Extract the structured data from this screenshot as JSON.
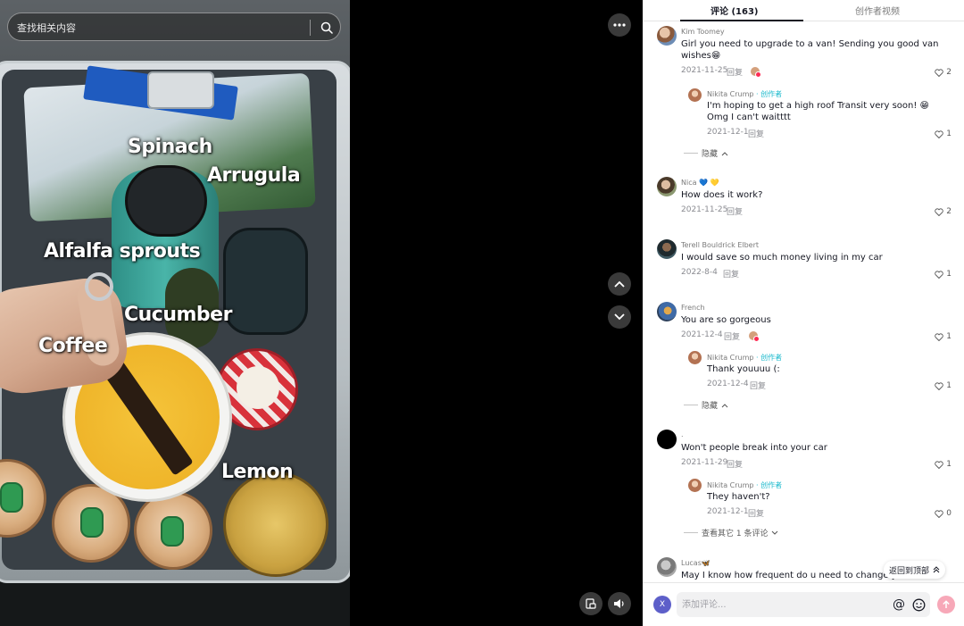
{
  "video": {
    "search_placeholder": "查找相关内容",
    "food_labels": {
      "spinach": "Spinach",
      "arrugula": "Arrugula",
      "alfalfa": "Alfalfa sprouts",
      "cucumber": "Cucumber",
      "coffee": "Coffee",
      "lemon": "Lemon"
    },
    "icons": {
      "search": "search-icon",
      "more": "more-horizontal-icon",
      "up": "chevron-up-icon",
      "down": "chevron-down-icon",
      "miniplayer": "miniplayer-icon",
      "volume": "volume-icon"
    }
  },
  "tabs": {
    "comments": "评论 (163)",
    "creator_videos": "创作者视频"
  },
  "comments": [
    {
      "user": "Kim Toomey",
      "text_line1": "Girl you need to upgrade to a van! Sending you good van",
      "text_line2": "wishes😁",
      "date": "2021-11-25",
      "reply": "回复",
      "likes": "2",
      "replies": [
        {
          "user": "Nikita Crump",
          "author_tag": "· 创作者",
          "text_line1": "I'm hoping to get a high roof Transit very soon! 😁",
          "text_line2": "Omg I can't waitttt",
          "date": "2021-12-1",
          "reply": "回复",
          "likes": "1"
        }
      ],
      "toggle": "隐藏"
    },
    {
      "user": "Nica",
      "user_badges": "💙 💛",
      "text_line1": "How does it work?",
      "date": "2021-11-25",
      "reply": "回复",
      "likes": "2"
    },
    {
      "user": "Terell Bouldrick Elbert",
      "text_line1": "I would save so much money living in my car",
      "date": "2022-8-4",
      "reply": "回复",
      "likes": "1"
    },
    {
      "user": "French",
      "text_line1": "You are so gorgeous",
      "date": "2021-12-4",
      "reply": "回复",
      "likes": "1",
      "replies": [
        {
          "user": "Nikita Crump",
          "author_tag": "· 创作者",
          "text_line1": "Thank youuuu (:",
          "date": "2021-12-4",
          "reply": "回复",
          "likes": "1"
        }
      ],
      "toggle": "隐藏"
    },
    {
      "user": ".",
      "text_line1": "Won't people break into your car",
      "date": "2021-11-29",
      "reply": "回复",
      "likes": "1",
      "replies": [
        {
          "user": "Nikita Crump",
          "author_tag": "· 创作者",
          "text_line1": "They haven't?",
          "date": "2021-12-1",
          "reply": "回复",
          "likes": "0"
        }
      ],
      "toggle": "查看其它 1 条评论"
    },
    {
      "user": "Lucas🦋",
      "text_line1": "May I know how frequent do u need to change your car"
    }
  ],
  "back_to_top": "返回到顶部",
  "composer": {
    "avatar_letter": "X",
    "placeholder": "添加评论...",
    "mention": "@"
  },
  "colors": {
    "author_tag": "#19b9cc",
    "send_button": "#f7a8b8",
    "my_avatar": "#5d5fc9"
  }
}
